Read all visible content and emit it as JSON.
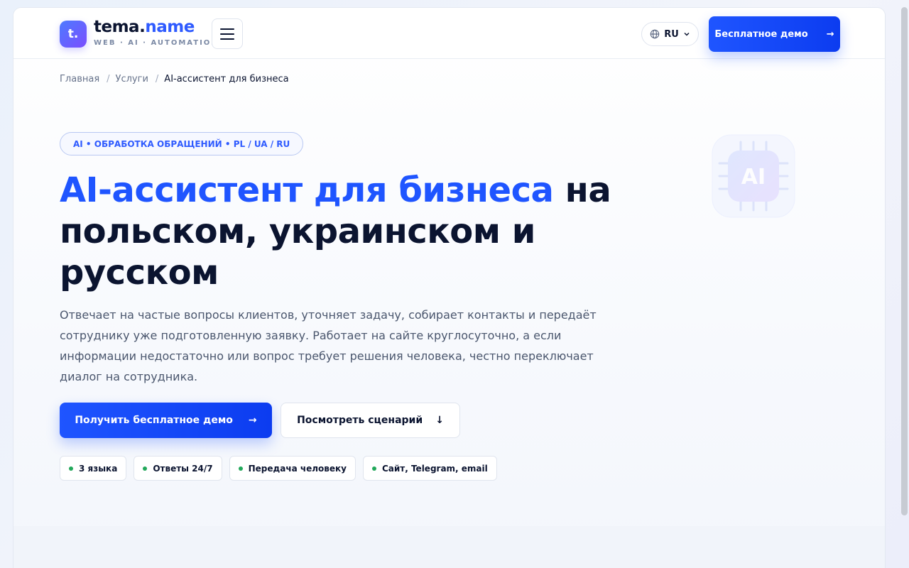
{
  "header": {
    "logo_mark": "t.",
    "logo_name_part1": "tema.",
    "logo_name_part2": "name",
    "logo_tagline": "WEB · AI · AUTOMATION",
    "language": "RU",
    "demo_button": "Бесплатное демо",
    "demo_arrow": "→"
  },
  "breadcrumbs": {
    "home": "Главная",
    "services": "Услуги",
    "current": "AI-ассистент для бизнеса",
    "separator": "/"
  },
  "hero": {
    "pill": "AI • ОБРАБОТКА ОБРАЩЕНИЙ • PL / UA / RU",
    "title_highlight": "AI-ассистент для бизнеса",
    "title_rest": "на польском, украинском и русском",
    "description": "Отвечает на частые вопросы клиентов, уточняет задачу, собирает контакты и передаёт сотруднику уже подготовленную заявку. Работает на сайте круглосуточно, а если информации недостаточно или вопрос требует решения человека, честно переключает диалог на сотрудника.",
    "cta_primary": "Получить бесплатное демо",
    "cta_primary_arrow": "→",
    "cta_secondary": "Посмотреть сценарий",
    "cta_secondary_arrow": "↓",
    "chips": [
      "3 языка",
      "Ответы 24/7",
      "Передача человеку",
      "Сайт, Telegram, email"
    ],
    "badge_text": "AI"
  },
  "icons": {
    "menu": "hamburger-icon",
    "language": "globe-icon",
    "language_dropdown": "chevron-down-icon",
    "decor": "ai-chip-icon"
  },
  "colors": {
    "accent": "#1f55ff",
    "text_dark": "#0b1430",
    "status_dot": "#22a85a"
  }
}
